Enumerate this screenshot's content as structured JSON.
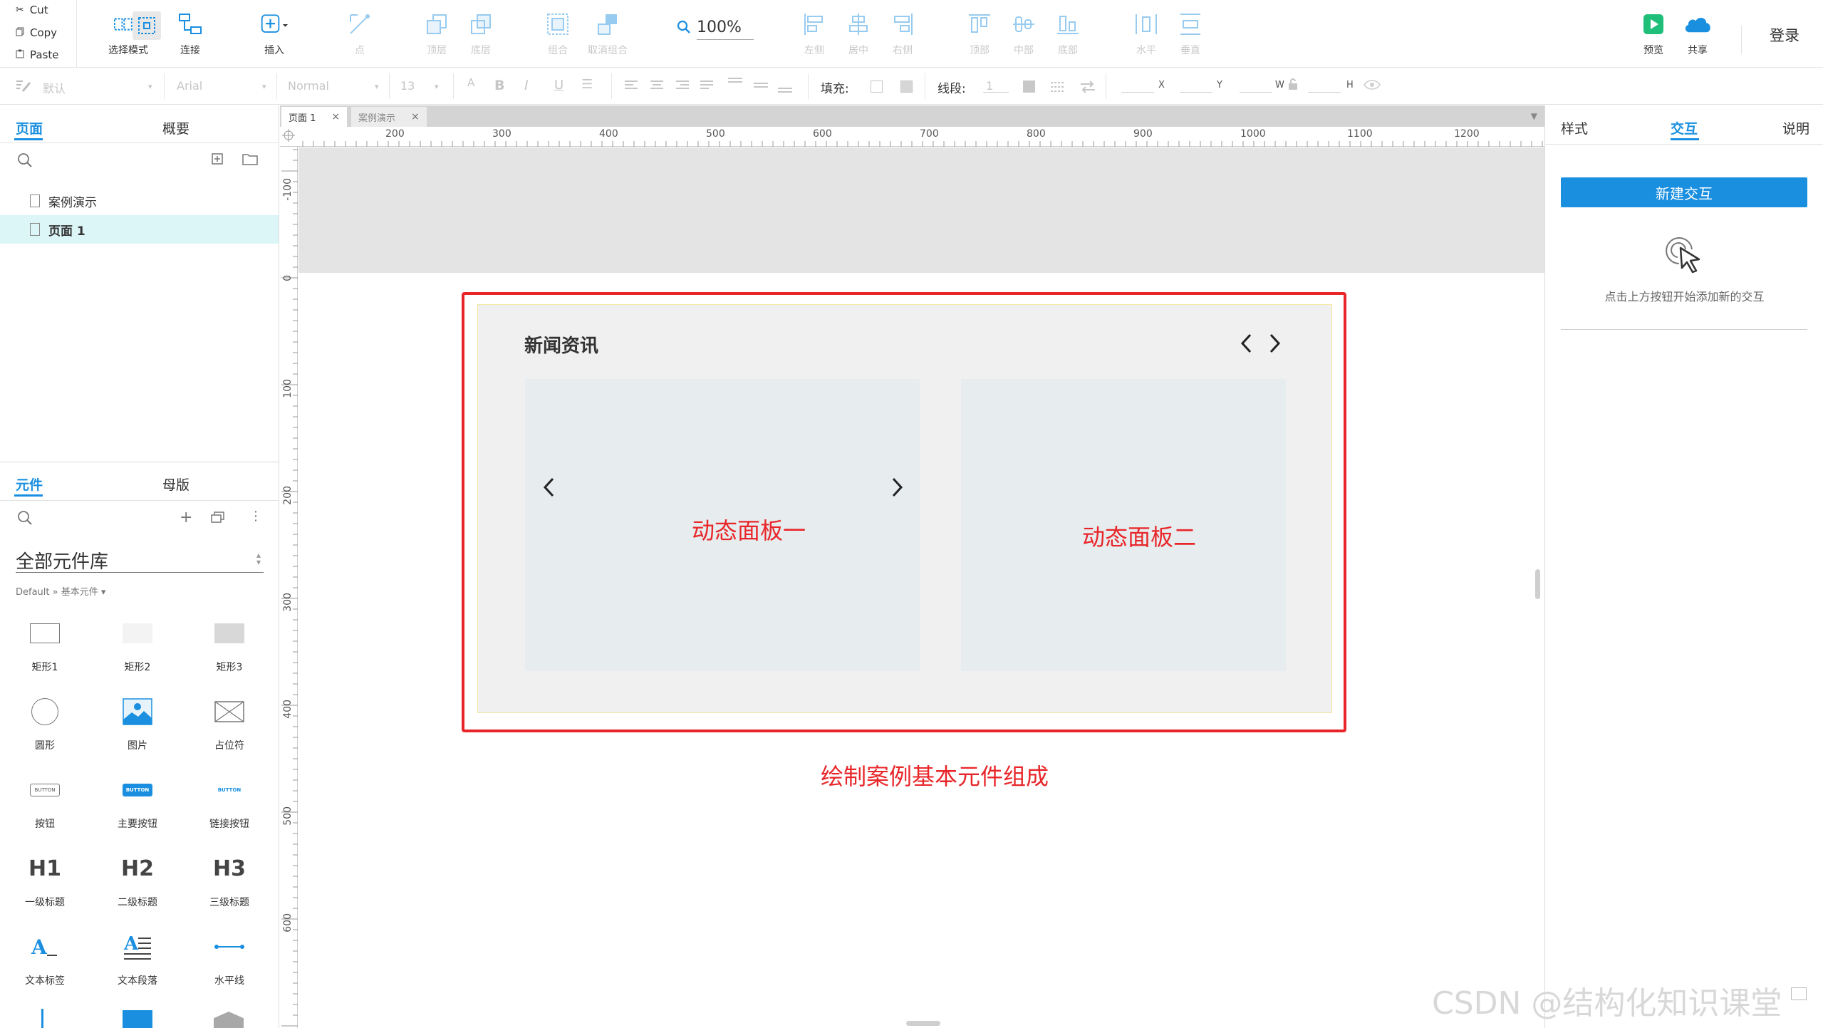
{
  "toolbar": {
    "clipboard": {
      "cut": "Cut",
      "copy": "Copy",
      "paste": "Paste"
    },
    "buttons": [
      {
        "label": "选择模式",
        "icon": "select-mode-icon",
        "enabled": true
      },
      {
        "label": "连接",
        "icon": "connect-icon",
        "enabled": true
      },
      {
        "label": "插入",
        "icon": "insert-icon",
        "enabled": true
      },
      {
        "label": "点",
        "icon": "point-icon",
        "enabled": false
      },
      {
        "label": "顶层",
        "icon": "bring-to-front-icon",
        "enabled": false
      },
      {
        "label": "底层",
        "icon": "send-to-back-icon",
        "enabled": false
      },
      {
        "label": "组合",
        "icon": "group-icon",
        "enabled": false
      },
      {
        "label": "取消组合",
        "icon": "ungroup-icon",
        "enabled": false
      },
      {
        "label": "左侧",
        "icon": "align-left-icon",
        "enabled": false
      },
      {
        "label": "居中",
        "icon": "align-center-icon",
        "enabled": false
      },
      {
        "label": "右侧",
        "icon": "align-right-icon",
        "enabled": false
      },
      {
        "label": "顶部",
        "icon": "align-top-icon",
        "enabled": false
      },
      {
        "label": "中部",
        "icon": "align-middle-icon",
        "enabled": false
      },
      {
        "label": "底部",
        "icon": "align-bottom-icon",
        "enabled": false
      },
      {
        "label": "水平",
        "icon": "distribute-horizontal-icon",
        "enabled": false
      },
      {
        "label": "垂直",
        "icon": "distribute-vertical-icon",
        "enabled": false
      },
      {
        "label": "预览",
        "icon": "preview-icon",
        "enabled": true
      },
      {
        "label": "共享",
        "icon": "share-cloud-icon",
        "enabled": true
      }
    ],
    "zoom": "100%",
    "login": "登录"
  },
  "format_bar": {
    "style_select": "默认",
    "font_select": "Arial",
    "weight_select": "Normal",
    "size_select": "13",
    "fill_label": "填充:",
    "stroke_label": "线段:",
    "stroke_value": "1",
    "x_label": "X",
    "y_label": "Y",
    "w_label": "W",
    "h_label": "H"
  },
  "left_panel": {
    "tabs": [
      "页面",
      "概要"
    ],
    "pages": [
      {
        "name": "案例演示",
        "selected": false
      },
      {
        "name": "页面 1",
        "selected": true
      }
    ],
    "lib_tabs": [
      "元件",
      "母版"
    ],
    "library_title": "全部元件库",
    "library_path": "Default » 基本元件 ▾",
    "widgets": [
      {
        "label": "矩形1",
        "icon": "rectangle1-icon"
      },
      {
        "label": "矩形2",
        "icon": "rectangle2-icon"
      },
      {
        "label": "矩形3",
        "icon": "rectangle3-icon"
      },
      {
        "label": "圆形",
        "icon": "circle-icon"
      },
      {
        "label": "图片",
        "icon": "image-icon"
      },
      {
        "label": "占位符",
        "icon": "placeholder-icon"
      },
      {
        "label": "按钮",
        "icon": "button-icon",
        "text": "BUTTON"
      },
      {
        "label": "主要按钮",
        "icon": "primary-button-icon",
        "text": "BUTTON"
      },
      {
        "label": "链接按钮",
        "icon": "link-button-icon",
        "text": "BUTTON"
      },
      {
        "label": "一级标题",
        "icon": "h1-icon",
        "text": "H1"
      },
      {
        "label": "二级标题",
        "icon": "h2-icon",
        "text": "H2"
      },
      {
        "label": "三级标题",
        "icon": "h3-icon",
        "text": "H3"
      },
      {
        "label": "文本标签",
        "icon": "text-label-icon"
      },
      {
        "label": "文本段落",
        "icon": "text-paragraph-icon"
      },
      {
        "label": "水平线",
        "icon": "horizontal-line-icon"
      }
    ]
  },
  "canvas": {
    "tabs": [
      {
        "label": "页面 1",
        "active": true
      },
      {
        "label": "案例演示",
        "active": false
      }
    ],
    "ruler_h": [
      "200",
      "300",
      "400",
      "500",
      "600",
      "700",
      "800",
      "900",
      "1000",
      "1100",
      "1200"
    ],
    "ruler_v": [
      "-100",
      "0",
      "100",
      "200",
      "300",
      "400",
      "500",
      "600"
    ],
    "news_title": "新闻资讯",
    "panel1_label": "动态面板一",
    "panel2_label": "动态面板二",
    "caption": "绘制案例基本元件组成"
  },
  "right_panel": {
    "tabs": [
      "样式",
      "交互",
      "说明"
    ],
    "active_tab": "交互",
    "new_interaction": "新建交互",
    "hint": "点击上方按钮开始添加新的交互"
  },
  "watermark": "CSDN @结构化知识课堂",
  "colors": {
    "accent": "#1a8fe0",
    "annotation": "#e8262a",
    "selected_page": "#dcf5f7"
  }
}
